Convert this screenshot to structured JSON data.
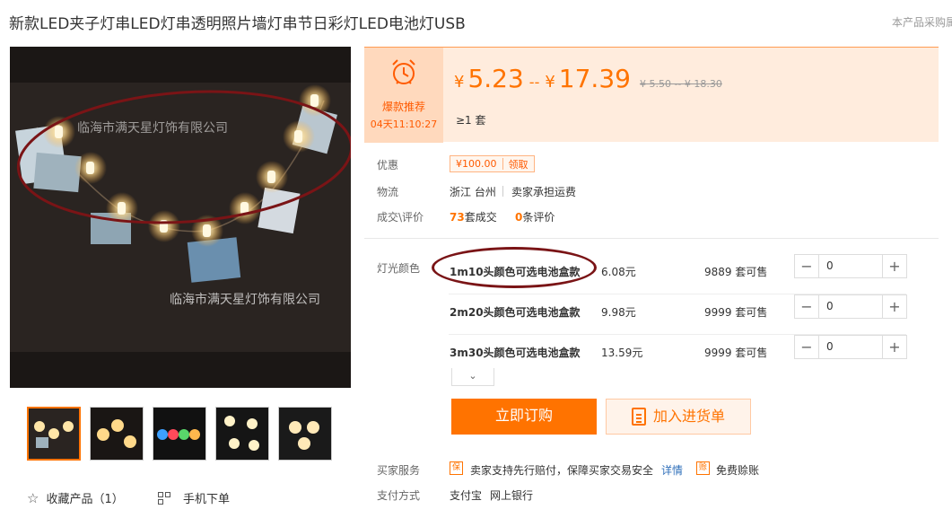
{
  "product": {
    "title": "新款LED夹子灯串LED灯串透明照片墙灯串节日彩灯LED电池灯USB",
    "title_right": "本产品采购属"
  },
  "gallery": {
    "watermark_top": "临海市满天星灯饰有限公司",
    "watermark_bottom": "临海市满天星灯饰有限公司",
    "thumbnail_count": 5
  },
  "actions": {
    "favorite_label": "收藏产品（1）",
    "mobile_order_label": "手机下单"
  },
  "promo": {
    "label": "爆款推荐",
    "countdown": "04天11:10:27"
  },
  "price": {
    "currency": "¥",
    "min": "5.23",
    "max": "17.39",
    "separator": "--",
    "old": "¥ 5.50 -- ¥ 18.30",
    "moq": "≥1 套"
  },
  "details": {
    "discount_label": "优惠",
    "coupon_value": "¥100.00",
    "coupon_action": "领取",
    "logistics_label": "物流",
    "origin": "浙江 台州",
    "shipping": "卖家承担运费",
    "deals_label": "成交\\评价",
    "deals_count": "73",
    "deals_unit": "套成交",
    "reviews_count": "0",
    "reviews_unit": "条评价"
  },
  "sku": {
    "label": "灯光颜色",
    "rows": [
      {
        "name": "1m10头颜色可选电池盒款",
        "price": "6.08元",
        "stock": "9889 套可售",
        "qty": "0"
      },
      {
        "name": "2m20头颜色可选电池盒款",
        "price": "9.98元",
        "stock": "9999 套可售",
        "qty": "0"
      },
      {
        "name": "3m30头颜色可选电池盒款",
        "price": "13.59元",
        "stock": "9999 套可售",
        "qty": "0"
      }
    ],
    "expand_icon": "chevron-down-icon"
  },
  "buttons": {
    "buy_now": "立即订购",
    "add_to_list": "加入进货单"
  },
  "service": {
    "buyer_label": "买家服务",
    "tag1": "保",
    "text1": "卖家支持先行赔付，保障买家交易安全",
    "details_link": "详情",
    "tag2": "赊",
    "text2": "免费赊账",
    "payment_label": "支付方式",
    "pay1": "支付宝",
    "pay2": "网上银行"
  },
  "colors": {
    "accent": "#ff7300",
    "annotation": "#7a1416",
    "price_bg": "#ffecdd"
  }
}
